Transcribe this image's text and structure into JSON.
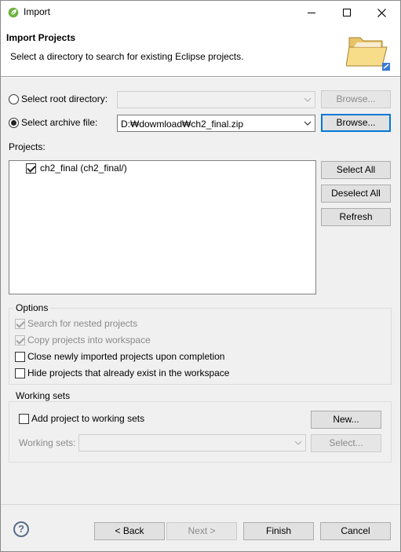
{
  "window": {
    "title": "Import",
    "app_icon": "spring-leaf-icon",
    "controls": [
      "minimize-icon",
      "maximize-icon",
      "close-icon"
    ]
  },
  "header": {
    "title": "Import Projects",
    "description": "Select a directory to search for existing Eclipse projects.",
    "icon": "folder-open-icon"
  },
  "source": {
    "root_dir_label": "Select root directory:",
    "root_dir_value": "",
    "root_dir_browse": "Browse...",
    "archive_label": "Select archive file:",
    "archive_value": "D:₩dowmload₩ch2_final.zip",
    "archive_browse": "Browse...",
    "selected": "archive"
  },
  "projects": {
    "label": "Projects:",
    "items": [
      {
        "label": "ch2_final (ch2_final/)",
        "checked": true
      }
    ],
    "buttons": {
      "select_all": "Select All",
      "deselect_all": "Deselect All",
      "refresh": "Refresh"
    }
  },
  "options": {
    "title": "Options",
    "items": [
      {
        "label": "Search for nested projects",
        "checked": true,
        "enabled": false
      },
      {
        "label": "Copy projects into workspace",
        "checked": true,
        "enabled": false
      },
      {
        "label": "Close newly imported projects upon completion",
        "checked": false,
        "enabled": true
      },
      {
        "label": "Hide projects that already exist in the workspace",
        "checked": false,
        "enabled": true
      }
    ]
  },
  "working_sets": {
    "title": "Working sets",
    "add_label": "Add project to working sets",
    "add_checked": false,
    "new_button": "New...",
    "sets_label": "Working sets:",
    "sets_value": "",
    "select_button": "Select..."
  },
  "footer": {
    "help_symbol": "?",
    "back": "< Back",
    "next": "Next >",
    "finish": "Finish",
    "cancel": "Cancel"
  },
  "colors": {
    "dialog_bg": "#f0f0f0",
    "default_button_border": "#0078d7",
    "disabled_text": "#8a8a8a"
  }
}
